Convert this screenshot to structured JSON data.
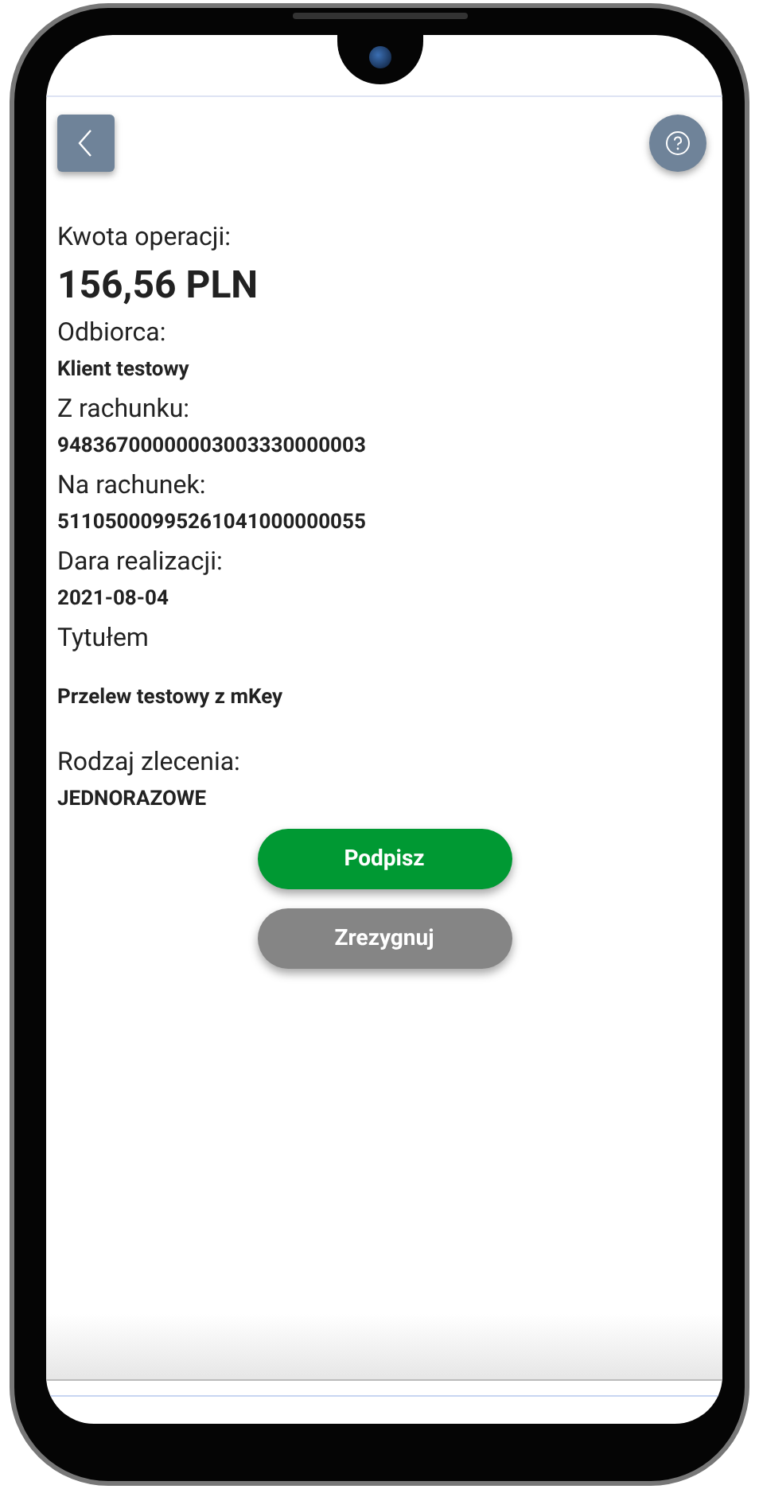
{
  "amount": {
    "label": "Kwota operacji:",
    "value": "156,56 PLN"
  },
  "details": [
    {
      "kind": "plain",
      "label": "Odbiorca:",
      "value": "Klient testowy"
    },
    {
      "kind": "plain",
      "label": "Z rachunku:",
      "value": "94836700000003003330000003"
    },
    {
      "kind": "plain",
      "label": "Na rachunek:",
      "value": "51105000995261041000000055"
    },
    {
      "kind": "plain",
      "label": "Dara realizacji:",
      "value": "2021-08-04"
    },
    {
      "kind": "spaced",
      "label": "Tytułem",
      "value": "Przelew testowy z mKey"
    },
    {
      "kind": "plain",
      "label": "Rodzaj zlecenia:",
      "value": "JEDNORAZOWE"
    }
  ],
  "buttons": [
    {
      "kind": "primary",
      "label": "Podpisz"
    },
    {
      "kind": "secondary",
      "label": "Zrezygnuj"
    }
  ]
}
